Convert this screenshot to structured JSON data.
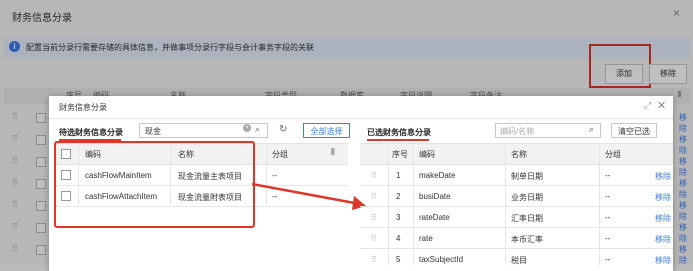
{
  "outer": {
    "title": "财务信息分录",
    "close": "×",
    "info": "配置当前分录行需要存储的具体信息，并做事项分录行字段与会计事务字段的关联",
    "add_button": "添加",
    "remove_button": "移除",
    "bg_headers": [
      "序号",
      "编码",
      "名称",
      "字段类型",
      "数据库",
      "字段说明",
      "字段备注"
    ],
    "bg_row_links": [
      "移除",
      "移除",
      "移除",
      "移除",
      "移除",
      "移除",
      "移除",
      "移除"
    ]
  },
  "inner": {
    "title": "财务信息分录",
    "expand_icon": "⤢",
    "close": "✕",
    "left": {
      "title": "待选财务信息分录",
      "search_value": "现金",
      "select_all": "全部选择",
      "headers": {
        "code": "编码",
        "name": "名称",
        "group": "分组"
      },
      "rows": [
        {
          "code": "cashFlowMainItem",
          "name": "现金流量主表项目",
          "group": "--"
        },
        {
          "code": "cashFlowAttachItem",
          "name": "现金流量附表项目",
          "group": "--"
        }
      ]
    },
    "right": {
      "title": "已选财务信息分录",
      "search_placeholder": "编码/名称",
      "clear_selected": "清空已选",
      "headers": {
        "seq": "序号",
        "code": "编码",
        "name": "名称",
        "group": "分组"
      },
      "rows": [
        {
          "seq": "1",
          "code": "makeDate",
          "name": "制单日期",
          "group": "--",
          "action": "移除"
        },
        {
          "seq": "2",
          "code": "busiDate",
          "name": "业务日期",
          "group": "--",
          "action": "移除"
        },
        {
          "seq": "3",
          "code": "rateDate",
          "name": "汇率日期",
          "group": "--",
          "action": "移除"
        },
        {
          "seq": "4",
          "code": "rate",
          "name": "本币汇率",
          "group": "--",
          "action": "移除"
        },
        {
          "seq": "5",
          "code": "taxSubjectId",
          "name": "税目",
          "group": "--",
          "action": "移除"
        }
      ]
    }
  },
  "colors": {
    "accent": "#3c7df0",
    "highlight": "#e0352b"
  }
}
